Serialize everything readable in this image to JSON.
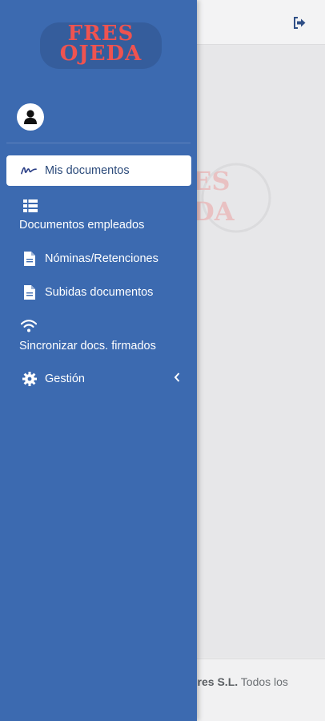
{
  "brand": {
    "line1": "FRES",
    "line2": "OJEDA",
    "color": "#ef5350"
  },
  "drawer": {
    "background": "#3c6ab0",
    "items": [
      {
        "label": "Mis documentos",
        "icon": "signature-icon",
        "active": true
      },
      {
        "label": "Documentos empleados",
        "icon": "table-icon"
      },
      {
        "label": "Nóminas/Retenciones",
        "icon": "document-icon"
      },
      {
        "label": "Subidas documentos",
        "icon": "document-icon"
      },
      {
        "label": "Sincronizar docs. firmados",
        "icon": "wifi-icon"
      },
      {
        "label": "Gestión",
        "icon": "gear-icon",
        "has_submenu": true
      }
    ]
  },
  "header": {
    "logout_icon": "logout-icon"
  },
  "footer": {
    "company": "ores S.L.",
    "rights": "Todos los"
  }
}
